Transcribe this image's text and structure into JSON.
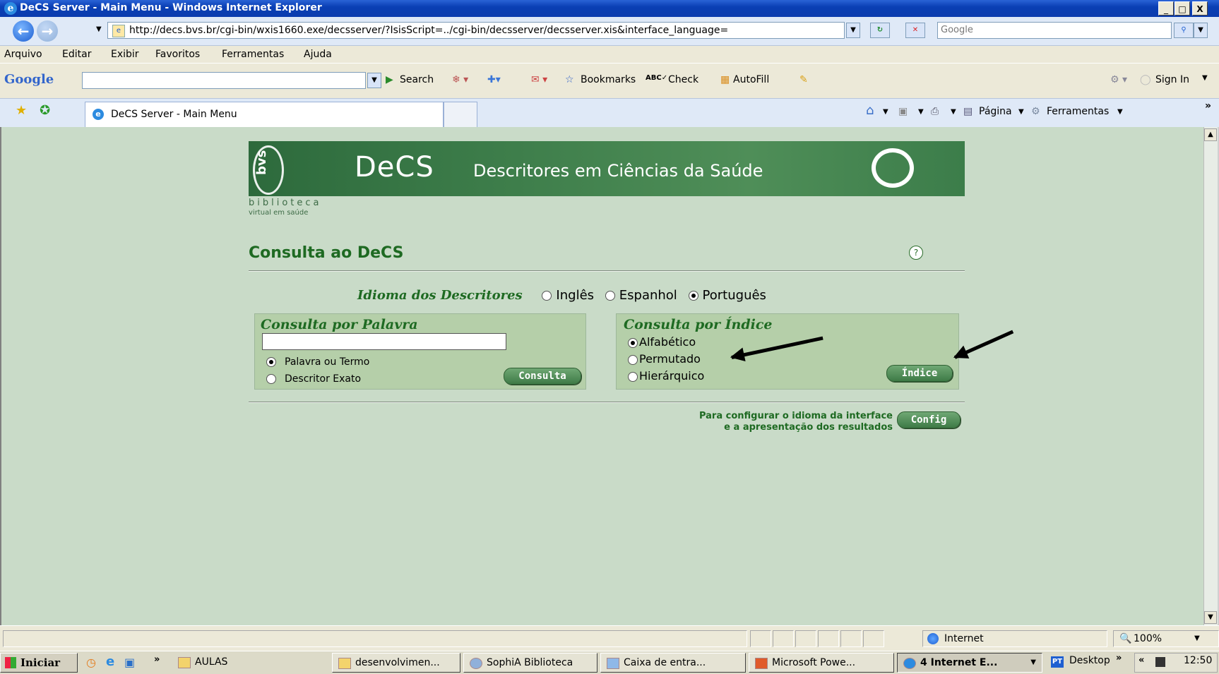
{
  "window": {
    "title": "DeCS Server - Main Menu - Windows Internet Explorer",
    "min": "_",
    "max": "□",
    "close": "X"
  },
  "browser": {
    "address": "http://decs.bvs.br/cgi-bin/wxis1660.exe/decsserver/?IsisScript=../cgi-bin/decsserver/decsserver.xis&interface_language=",
    "search_placeholder": "Google",
    "menu": [
      "Arquivo",
      "Editar",
      "Exibir",
      "Favoritos",
      "Ferramentas",
      "Ajuda"
    ],
    "google_toolbar": {
      "logo": "Google",
      "search_label": "Search",
      "bookmarks_label": "Bookmarks",
      "check_label": "Check",
      "autofill_label": "AutoFill",
      "signin_label": "Sign In"
    },
    "tab_title": "DeCS Server - Main Menu",
    "command_bar": {
      "pagina_label": "Página",
      "ferramentas_label": "Ferramentas",
      "more": "»"
    }
  },
  "page": {
    "banner": {
      "bvs": "bvs",
      "decs": "DeCS",
      "description": "Descritores em Ciências da Saúde"
    },
    "biblioteca": "biblioteca",
    "biblioteca_sub": "virtual em saúde",
    "title": "Consulta ao DeCS",
    "help": "?",
    "idioma_label": "Idioma dos Descritores",
    "idioma_options": [
      "Inglês",
      "Espanhol",
      "Português"
    ],
    "idioma_selected": "Português",
    "palavra_panel": {
      "title": "Consulta por Palavra",
      "input_value": "",
      "options": [
        "Palavra ou Termo",
        "Descritor Exato"
      ],
      "button": "Consulta"
    },
    "indice_panel": {
      "title": "Consulta por Índice",
      "options": [
        "Alfabético",
        "Permutado",
        "Hierárquico"
      ],
      "button": "Índice"
    },
    "config_text_1": "Para configurar o idioma da interface",
    "config_text_2": "e a apresentação dos resultados",
    "config_button": "Config"
  },
  "statusbar": {
    "zone": "Internet",
    "zoom": "100%"
  },
  "taskbar": {
    "start": "Iniciar",
    "more": "»",
    "tasks": [
      "AULAS",
      "desenvolvimen...",
      "SophiA Biblioteca",
      "Caixa de entra...",
      "Microsoft Powe...",
      "4 Internet E..."
    ],
    "lang": "PT",
    "desktop": "Desktop",
    "clock": "12:50"
  }
}
